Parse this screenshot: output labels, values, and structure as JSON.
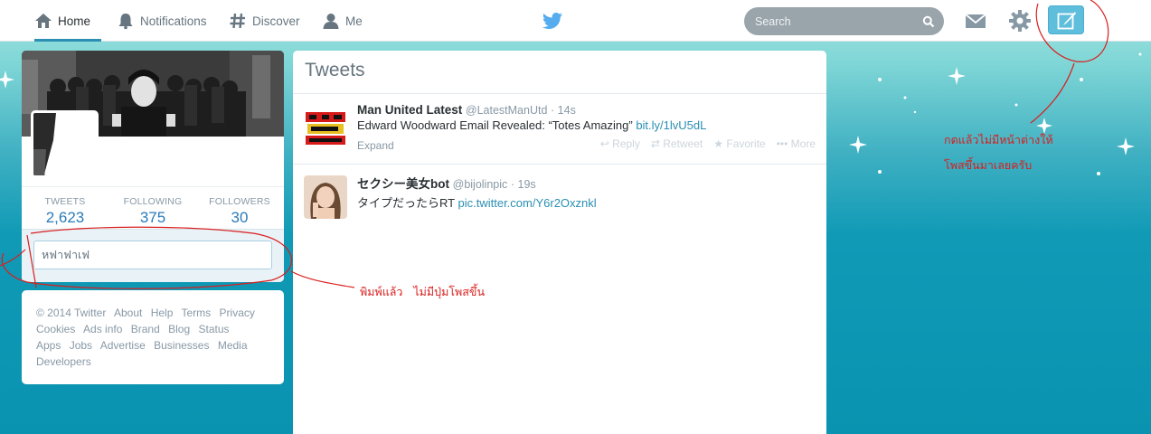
{
  "nav": {
    "home": "Home",
    "notifications": "Notifications",
    "discover": "Discover",
    "me": "Me"
  },
  "search": {
    "placeholder": "Search"
  },
  "colors": {
    "accent": "#2a8fb2",
    "topbar": "#ffffff",
    "compose_button": "#5fbedb",
    "annotation": "#d91e1e",
    "background_bottom": "#0a93b0"
  },
  "icons": [
    "home-icon",
    "bell-icon",
    "hash-icon",
    "person-icon",
    "twitter-bird-icon",
    "search-icon",
    "envelope-icon",
    "gear-icon",
    "compose-quill-icon"
  ],
  "profile": {
    "stats": [
      {
        "label": "TWEETS",
        "value": "2,623"
      },
      {
        "label": "FOLLOWING",
        "value": "375"
      },
      {
        "label": "FOLLOWERS",
        "value": "30"
      }
    ],
    "composer_value": "หฟาฟาเฟ"
  },
  "footer": {
    "links": [
      "© 2014 Twitter",
      "About",
      "Help",
      "Terms",
      "Privacy",
      "Cookies",
      "Ads info",
      "Brand",
      "Blog",
      "Status",
      "Apps",
      "Jobs",
      "Advertise",
      "Businesses",
      "Media",
      "Developers"
    ]
  },
  "tweets": {
    "header": "Tweets",
    "items": [
      {
        "name": "Man United Latest",
        "handle": "@LatestManUtd",
        "time": "· 14s",
        "text": "Edward Woodward Email Revealed: “Totes Amazing”",
        "link": "bit.ly/1lvU5dL",
        "expand": "Expand",
        "actions": {
          "reply": "Reply",
          "retweet": "Retweet",
          "favorite": "Favorite",
          "more": "More"
        }
      },
      {
        "name": "セクシー美女bot",
        "handle": "@bijolinpic",
        "time": "· 19s",
        "text": "タイプだったらRT",
        "link": "pic.twitter.com/Y6r2Oxznkl"
      }
    ]
  },
  "annotations": {
    "top_right_line1": "กดแล้วไม่มีหน้าต่างให้",
    "top_right_line2": "โพสขึ้นมาเลยครับ",
    "middle": "พิมพ์แล้ว   ไม่มีปุ่มโพสขึ้น"
  }
}
